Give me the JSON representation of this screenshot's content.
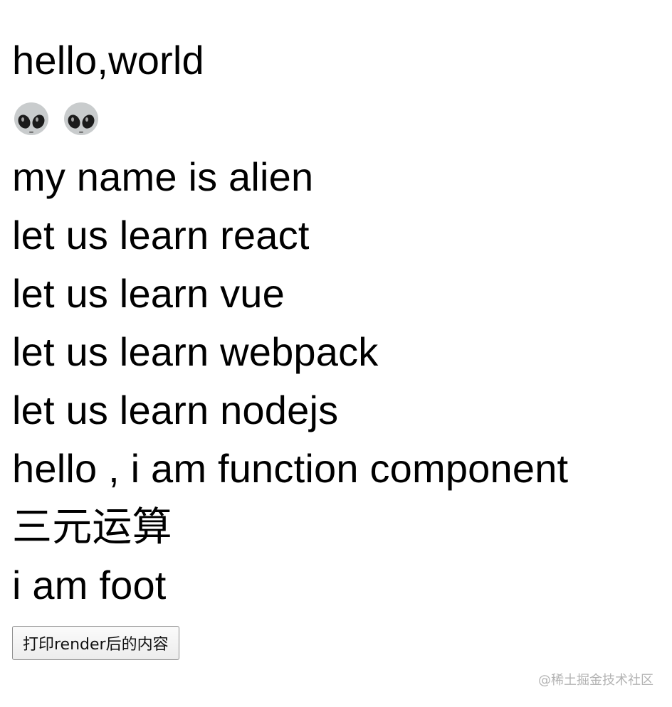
{
  "lines": {
    "greeting": "hello,world",
    "emoji_icons": [
      "alien-icon",
      "alien-icon"
    ],
    "name": "my name is alien",
    "react": "let us learn react",
    "vue": "let us learn vue",
    "webpack": "let us learn webpack",
    "nodejs": "let us learn nodejs",
    "function_component": "hello , i am function component",
    "ternary": "三元运算",
    "foot": "i am foot"
  },
  "button": {
    "label": "打印render后的内容"
  },
  "watermark": {
    "text": "@稀土掘金技术社区"
  }
}
